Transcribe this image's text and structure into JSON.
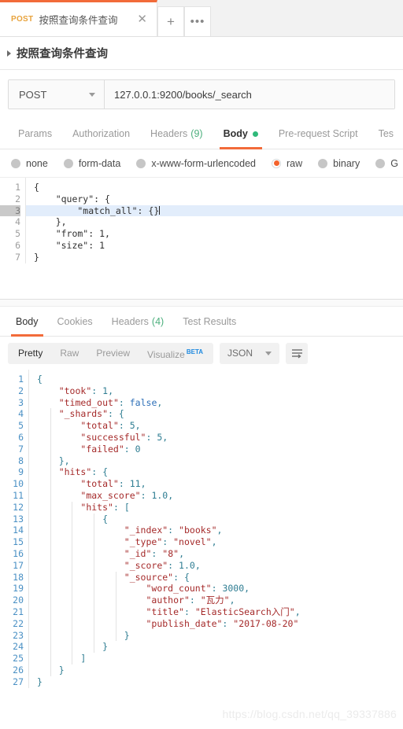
{
  "tabstrip": {
    "request_tab": {
      "method": "POST",
      "title": "按照查询条件查询",
      "close_icon": "close-icon"
    },
    "new_tab_label": "+",
    "more_label": "•••"
  },
  "request_name": "按照查询条件查询",
  "url_bar": {
    "method": "POST",
    "url": "127.0.0.1:9200/books/_search"
  },
  "request_tabs": [
    {
      "label": "Params",
      "active": false,
      "count": ""
    },
    {
      "label": "Authorization",
      "active": false,
      "count": ""
    },
    {
      "label": "Headers",
      "active": false,
      "count": "(9)"
    },
    {
      "label": "Body",
      "active": true,
      "count": ""
    },
    {
      "label": "Pre-request Script",
      "active": false,
      "count": ""
    },
    {
      "label": "Tes",
      "active": false,
      "count": ""
    }
  ],
  "body_types": [
    {
      "label": "none",
      "checked": false
    },
    {
      "label": "form-data",
      "checked": false
    },
    {
      "label": "x-www-form-urlencoded",
      "checked": false
    },
    {
      "label": "raw",
      "checked": true
    },
    {
      "label": "binary",
      "checked": false
    },
    {
      "label": "G",
      "checked": false
    }
  ],
  "request_body": {
    "lines": [
      {
        "n": "1",
        "text": "{"
      },
      {
        "n": "2",
        "text": "    \"query\": {"
      },
      {
        "n": "3",
        "text": "        \"match_all\": {}",
        "highlight": true
      },
      {
        "n": "4",
        "text": "    },"
      },
      {
        "n": "5",
        "text": "    \"from\": 1,"
      },
      {
        "n": "6",
        "text": "    \"size\": 1"
      },
      {
        "n": "7",
        "text": "}"
      }
    ]
  },
  "response_tabs": [
    {
      "label": "Body",
      "active": true,
      "count": ""
    },
    {
      "label": "Cookies",
      "active": false,
      "count": ""
    },
    {
      "label": "Headers",
      "active": false,
      "count": "(4)"
    },
    {
      "label": "Test Results",
      "active": false,
      "count": ""
    }
  ],
  "view_toolbar": {
    "segments": [
      {
        "label": "Pretty",
        "active": true
      },
      {
        "label": "Raw",
        "active": false
      },
      {
        "label": "Preview",
        "active": false
      },
      {
        "label": "Visualize",
        "active": false,
        "badge": "BETA"
      }
    ],
    "format": "JSON",
    "wrap_icon": "wrap-lines-icon"
  },
  "response_body": {
    "lines": [
      {
        "n": "1",
        "text": "{"
      },
      {
        "n": "2",
        "text": "    \"took\": 1,"
      },
      {
        "n": "3",
        "text": "    \"timed_out\": false,"
      },
      {
        "n": "4",
        "text": "    \"_shards\": {"
      },
      {
        "n": "5",
        "text": "        \"total\": 5,"
      },
      {
        "n": "6",
        "text": "        \"successful\": 5,"
      },
      {
        "n": "7",
        "text": "        \"failed\": 0"
      },
      {
        "n": "8",
        "text": "    },"
      },
      {
        "n": "9",
        "text": "    \"hits\": {"
      },
      {
        "n": "10",
        "text": "        \"total\": 11,"
      },
      {
        "n": "11",
        "text": "        \"max_score\": 1.0,"
      },
      {
        "n": "12",
        "text": "        \"hits\": ["
      },
      {
        "n": "13",
        "text": "            {"
      },
      {
        "n": "14",
        "text": "                \"_index\": \"books\","
      },
      {
        "n": "15",
        "text": "                \"_type\": \"novel\","
      },
      {
        "n": "16",
        "text": "                \"_id\": \"8\","
      },
      {
        "n": "17",
        "text": "                \"_score\": 1.0,"
      },
      {
        "n": "18",
        "text": "                \"_source\": {"
      },
      {
        "n": "19",
        "text": "                    \"word_count\": 3000,"
      },
      {
        "n": "20",
        "text": "                    \"author\": \"瓦力\","
      },
      {
        "n": "21",
        "text": "                    \"title\": \"ElasticSearch入门\","
      },
      {
        "n": "22",
        "text": "                    \"publish_date\": \"2017-08-20\""
      },
      {
        "n": "23",
        "text": "                }"
      },
      {
        "n": "24",
        "text": "            }"
      },
      {
        "n": "25",
        "text": "        ]"
      },
      {
        "n": "26",
        "text": "    }"
      },
      {
        "n": "27",
        "text": "}"
      }
    ]
  },
  "watermark": "https://blog.csdn.net/qq_39337886",
  "colors": {
    "accent": "#f26b3a",
    "method_post": "#e8a33d",
    "green": "#30b97a",
    "json_key": "#a52a2a",
    "json_number": "#2e7d92",
    "json_bool": "#2d6fb8",
    "radio_selected": "#f4622b"
  }
}
